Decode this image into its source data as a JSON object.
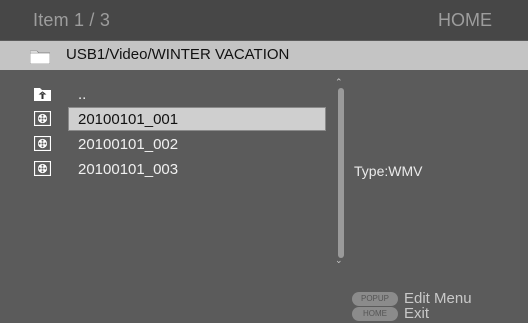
{
  "header": {
    "item_count": "Item 1 / 3",
    "home": "HOME"
  },
  "path": {
    "text": "USB1/Video/WINTER VACATION",
    "icon": "folder-icon"
  },
  "list": {
    "items": [
      {
        "label": "..",
        "icon": "folder-up-icon"
      },
      {
        "label": "20100101_001",
        "icon": "video-file-icon",
        "selected": true
      },
      {
        "label": "20100101_002",
        "icon": "video-file-icon"
      },
      {
        "label": "20100101_003",
        "icon": "video-file-icon"
      }
    ]
  },
  "info": {
    "type": "Type:WMV"
  },
  "legend": [
    {
      "key": "POPUP",
      "action": "Edit Menu"
    },
    {
      "key": "HOME",
      "action": "Exit"
    }
  ],
  "colors": {
    "background": "#5b5b5b",
    "topbar": "#474747",
    "pathbar": "#c4c4c4",
    "highlight": "#cfcfcf"
  }
}
